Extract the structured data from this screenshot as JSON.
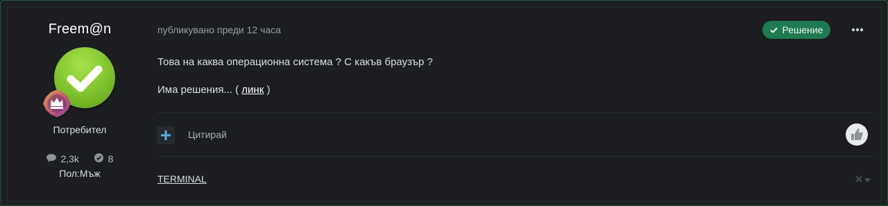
{
  "author": {
    "name": "Freem@n",
    "role": "Потребител",
    "posts_count": "2,3k",
    "solutions_count": "8",
    "gender": "Пол:Мъж"
  },
  "post": {
    "meta": "публикувано преди 12 часа",
    "solution_badge": "Решение",
    "line1": "Това на каква операционна система ? С какъв браузър ?",
    "line2_prefix": "Има решения... (",
    "line2_link": "линк",
    "line2_suffix": ")",
    "quote_label": "Цитирай",
    "signature": "TERMINAL"
  },
  "icons": {
    "more": "more-dots-icon",
    "add": "plus-icon",
    "like": "thumbs-up-icon",
    "comment": "comment-icon",
    "check": "check-circle-icon",
    "close": "close-icon",
    "caret": "caret-down-icon"
  },
  "colors": {
    "accent_green": "#1f7a52",
    "avatar_green": "#7cc22c",
    "link_blue": "#5aa9e6"
  }
}
